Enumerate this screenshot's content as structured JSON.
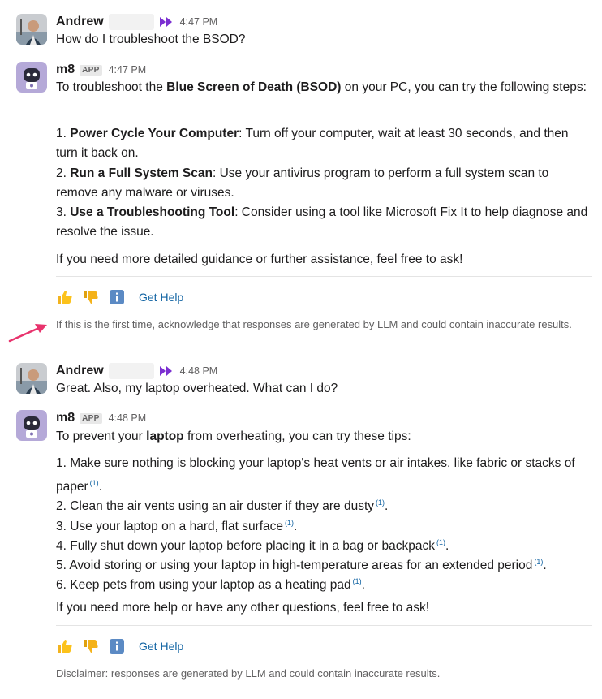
{
  "msg1": {
    "author": "Andrew",
    "time": "4:47 PM",
    "text": "How do I troubleshoot the BSOD?"
  },
  "msg2": {
    "author": "m8",
    "badge": "APP",
    "time": "4:47 PM",
    "intro_a": "To troubleshoot the ",
    "intro_bold": "Blue Screen of Death (BSOD)",
    "intro_b": " on your PC, you can try the following steps:",
    "steps": [
      {
        "num": "1. ",
        "bold": "Power Cycle Your Computer",
        "text": ": Turn off your computer, wait at least 30 seconds, and then turn it back on."
      },
      {
        "num": "2. ",
        "bold": "Run a Full System Scan",
        "text": ": Use your antivirus program to perform a full system scan to remove any malware or viruses."
      },
      {
        "num": "3. ",
        "bold": "Use a Troubleshooting Tool",
        "text": ": Consider using a tool like Microsoft Fix It to help diagnose and resolve the issue."
      }
    ],
    "closing": "If you need more detailed guidance or further assistance, feel free to ask!",
    "get_help": "Get Help",
    "note": "If this is the first time, acknowledge that responses are generated by LLM and could contain inaccurate results."
  },
  "msg3": {
    "author": "Andrew",
    "time": "4:48 PM",
    "text": "Great. Also, my laptop overheated. What can I do?"
  },
  "msg4": {
    "author": "m8",
    "badge": "APP",
    "time": "4:48 PM",
    "intro_a": "To prevent your ",
    "intro_bold": "laptop",
    "intro_b": " from overheating, you can try these tips:",
    "tips": [
      {
        "text": "1. Make sure nothing is blocking your laptop's heat vents or air intakes, like fabric or stacks of paper",
        "ref": "(1)",
        "end": "."
      },
      {
        "text": "2. Clean the air vents using an air duster if they are dusty",
        "ref": "(1)",
        "end": "."
      },
      {
        "text": "3. Use your laptop on a hard, flat surface",
        "ref": "(1)",
        "end": "."
      },
      {
        "text": "4. Fully shut down your laptop before placing it in a bag or backpack",
        "ref": "(1)",
        "end": "."
      },
      {
        "text": "5. Avoid storing or using your laptop in high-temperature areas for an extended period",
        "ref": "(1)",
        "end": "."
      },
      {
        "text": "6. Keep pets from using your laptop as a heating pad",
        "ref": "(1)",
        "end": "."
      }
    ],
    "closing": "If you need more help or have any other questions, feel free to ask!",
    "get_help": "Get Help",
    "disclaimer": "Disclaimer: responses are generated by LLM and could contain inaccurate results."
  },
  "colors": {
    "link": "#1264a3",
    "arrow": "#e8336d",
    "status_icon": "#7b2fd1",
    "bot_avatar_bg": "#9b8bc7"
  },
  "icons": {
    "reaction_up": "thumbs-up-icon",
    "reaction_down": "thumbs-down-icon",
    "info": "info-icon",
    "status": "double-play-icon"
  }
}
